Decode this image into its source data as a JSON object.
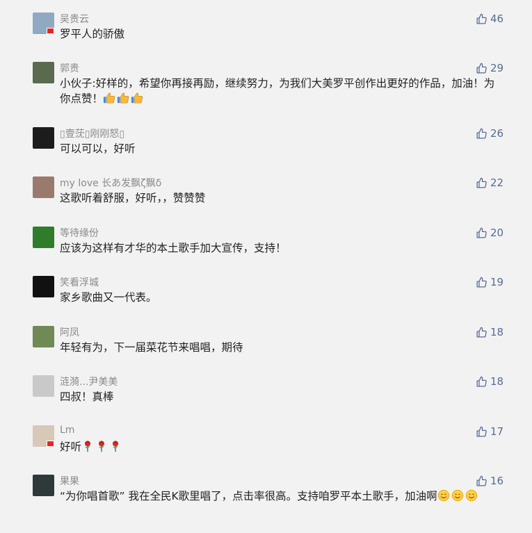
{
  "comments": [
    {
      "nickname": "吴贵云",
      "text": "罗平人的骄傲",
      "likes": "46",
      "avatar_color": "#8fa9c2",
      "flag": true,
      "emoji": []
    },
    {
      "nickname": "郭贵",
      "text": "小伙子:好样的，希望你再接再励，继续努力，为我们大美罗平创作出更好的作品，加油！为你点赞！",
      "likes": "29",
      "avatar_color": "#5a6a4e",
      "flag": false,
      "emoji": [
        "thumbs-up",
        "thumbs-up",
        "thumbs-up"
      ]
    },
    {
      "nickname": "▯壹莐▯刚刚怒▯",
      "text": "可以可以，好听",
      "likes": "26",
      "avatar_color": "#1c1c1c",
      "flag": false,
      "emoji": []
    },
    {
      "nickname": "my love 长あ发飘ζ飘δ",
      "text": "这歌听着舒服，好听，，赞赞赞",
      "likes": "22",
      "avatar_color": "#9a7a6c",
      "flag": false,
      "emoji": []
    },
    {
      "nickname": "等待缘份",
      "text": "应该为这样有才华的本土歌手加大宣传，支持！",
      "likes": "20",
      "avatar_color": "#2f7d2a",
      "flag": false,
      "emoji": []
    },
    {
      "nickname": "笑看浮城",
      "text": "家乡歌曲又一代表。",
      "likes": "19",
      "avatar_color": "#111111",
      "flag": false,
      "emoji": []
    },
    {
      "nickname": "阿凤",
      "text": "年轻有为，下一届菜花节来唱唱，期待",
      "likes": "18",
      "avatar_color": "#6f8a55",
      "flag": false,
      "emoji": []
    },
    {
      "nickname": "涟漪...尹美美",
      "text": "四叔！真棒",
      "likes": "18",
      "avatar_color": "#c9c9c9",
      "flag": false,
      "emoji": []
    },
    {
      "nickname": "Lm",
      "text": "好听",
      "likes": "17",
      "avatar_color": "#d8c8b8",
      "flag": true,
      "emoji": [
        "rose",
        "rose",
        "rose"
      ]
    },
    {
      "nickname": "果果",
      "text": "“为你唱首歌” 我在全民K歌里唱了，点击率很高。支持咱罗平本土歌手，加油啊",
      "likes": "16",
      "avatar_color": "#2e3a3a",
      "flag": false,
      "emoji": [
        "smile",
        "smile",
        "smile"
      ]
    }
  ]
}
